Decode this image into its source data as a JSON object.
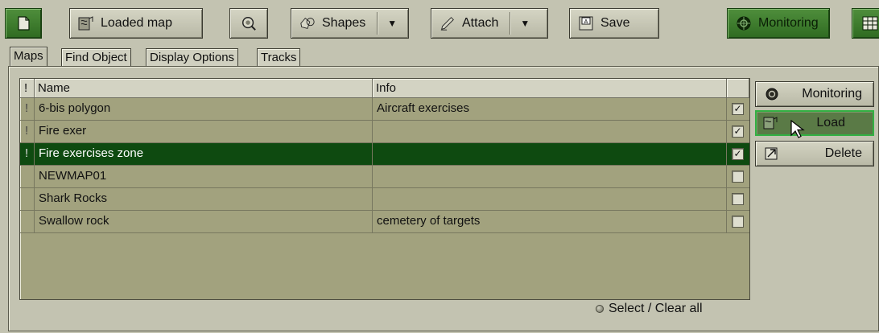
{
  "toolbar": {
    "loaded_map_label": "Loaded map",
    "shapes_label": "Shapes",
    "attach_label": "Attach",
    "save_label": "Save",
    "monitoring_label": "Monitoring"
  },
  "tabs": [
    {
      "label": "Maps"
    },
    {
      "label": "Find Object"
    },
    {
      "label": "Display Options"
    },
    {
      "label": "Tracks"
    }
  ],
  "table": {
    "columns": {
      "mark": "!",
      "name": "Name",
      "info": "Info"
    },
    "rows": [
      {
        "mark": "!",
        "name": "6-bis polygon",
        "info": "Aircraft exercises",
        "checked": true,
        "checkmark": "✓"
      },
      {
        "mark": "!",
        "name": "Fire exer",
        "info": "",
        "checked": true,
        "checkmark": "✓"
      },
      {
        "mark": "!",
        "name": "Fire exercises zone",
        "info": "",
        "checked": true,
        "checkmark": "✓",
        "selected": true
      },
      {
        "mark": "",
        "name": "NEWMAP01",
        "info": "",
        "checked": false,
        "checkmark": ""
      },
      {
        "mark": "",
        "name": "Shark Rocks",
        "info": "",
        "checked": false,
        "checkmark": ""
      },
      {
        "mark": "",
        "name": "Swallow rock",
        "info": "cemetery of targets",
        "checked": false,
        "checkmark": ""
      }
    ]
  },
  "side_buttons": {
    "monitoring_label": "Monitoring",
    "load_label": "Load",
    "delete_label": "Delete"
  },
  "footer": {
    "select_clear_label": "Select / Clear all"
  },
  "colors": {
    "background": "#c3c3b1",
    "grid_bg": "#a2a27e",
    "selected_row": "#0e4a10",
    "active_green": "#2f6b21"
  },
  "icons": [
    "new-map-icon",
    "loaded-map-icon",
    "search-map-icon",
    "shapes-icon",
    "attach-icon",
    "save-icon",
    "monitoring-icon",
    "table-icon",
    "load-icon",
    "delete-icon",
    "mouse-cursor-icon"
  ]
}
